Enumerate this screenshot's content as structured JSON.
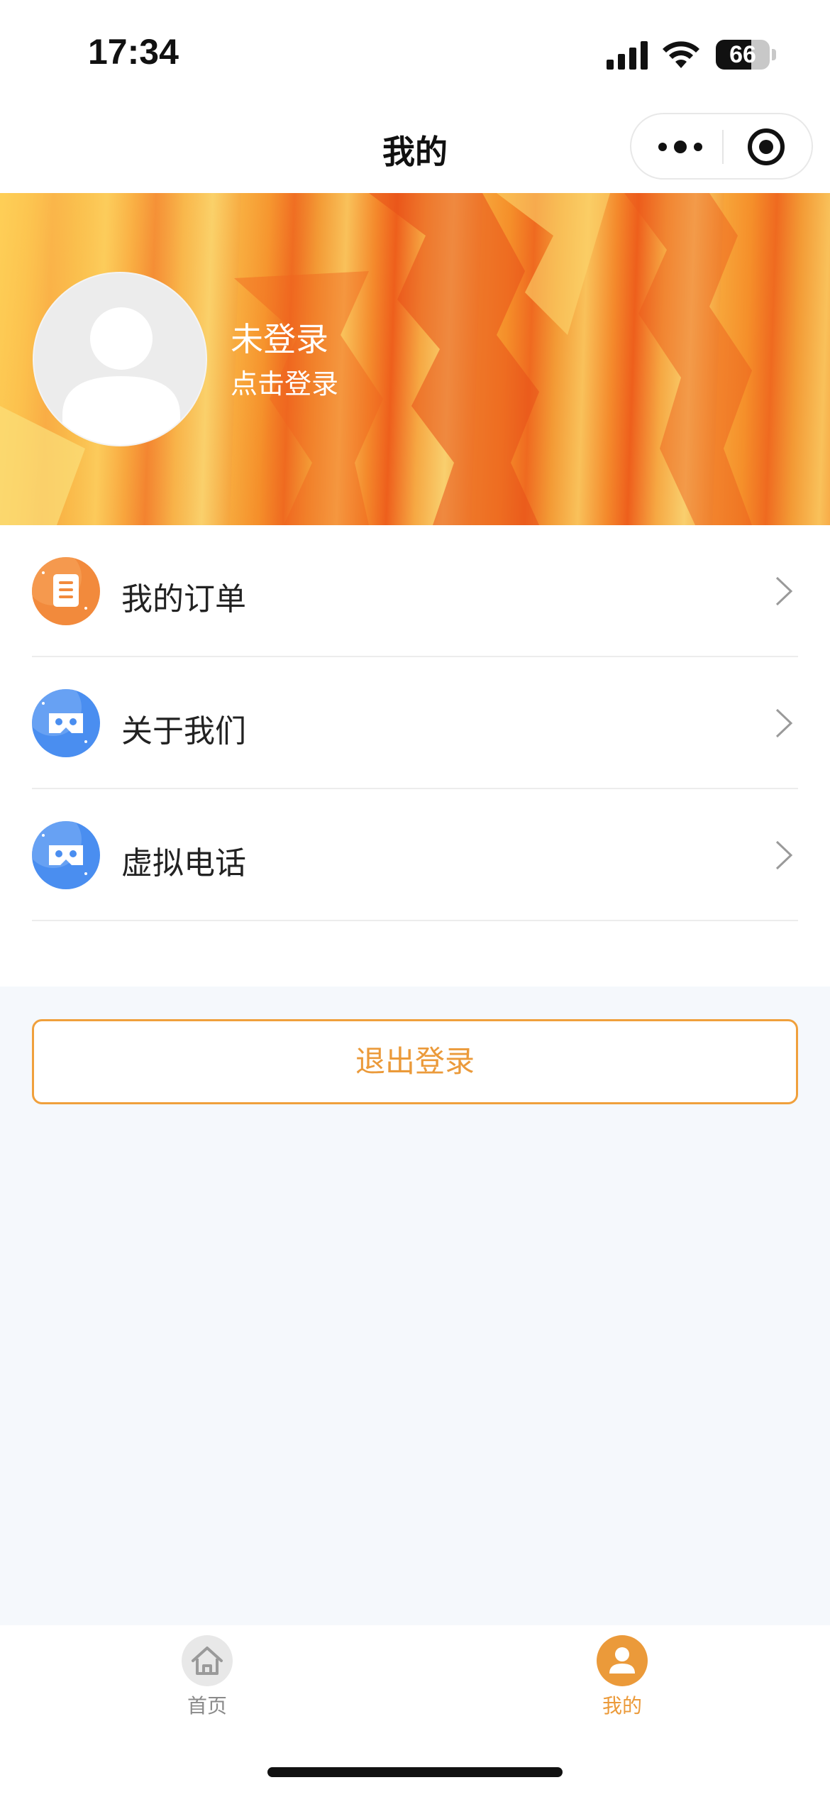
{
  "status_bar": {
    "time": "17:34",
    "battery_level": 66,
    "battery_text": "66"
  },
  "nav": {
    "title": "我的"
  },
  "profile": {
    "status": "未登录",
    "action": "点击登录"
  },
  "menu": {
    "items": [
      {
        "label": "我的订单",
        "icon": "order-doc-icon",
        "color": "#f28a3c"
      },
      {
        "label": "关于我们",
        "icon": "vr-glasses-icon",
        "color": "#4a8ef0"
      },
      {
        "label": "虚拟电话",
        "icon": "vr-glasses-icon",
        "color": "#4a8ef0"
      }
    ]
  },
  "logout": {
    "label": "退出登录"
  },
  "tabbar": {
    "items": [
      {
        "label": "首页",
        "icon": "home-icon",
        "active": false
      },
      {
        "label": "我的",
        "icon": "user-icon",
        "active": true
      }
    ]
  },
  "colors": {
    "accent": "#eb9a3a",
    "inactive": "#8a8a8a",
    "page_bg": "#f5f8fc"
  }
}
